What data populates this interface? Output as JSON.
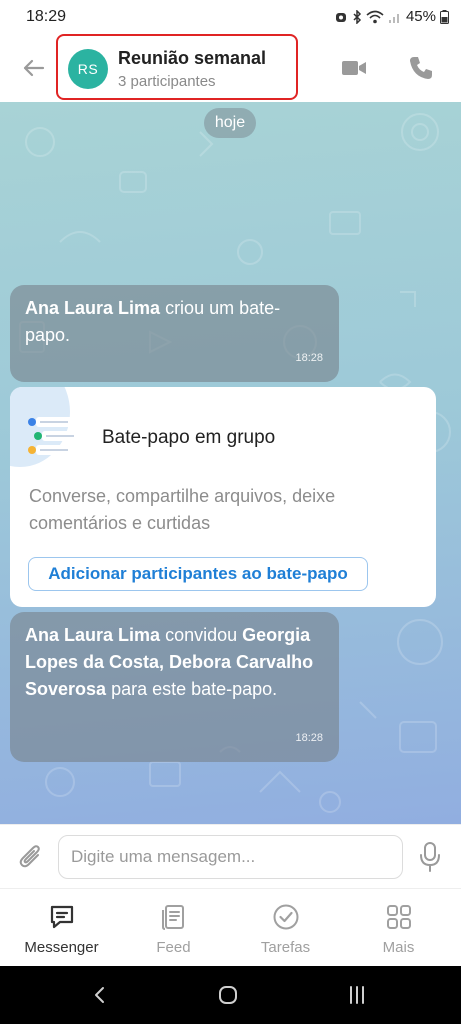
{
  "status_bar": {
    "time": "18:29",
    "battery": "45%"
  },
  "header": {
    "avatar_initials": "RS",
    "title": "Reunião semanal",
    "subtitle": "3 participantes",
    "back_icon": "arrow-left-icon",
    "video_icon": "video-camera-icon",
    "call_icon": "phone-icon"
  },
  "chat": {
    "date_label": "hoje",
    "messages": [
      {
        "author": "Ana Laura Lima",
        "text": "criou um bate-papo.",
        "time": "18:28"
      },
      {
        "author": "Ana Laura Lima",
        "text_pre": "convidou",
        "invitees": "Georgia Lopes da Costa, Debora Carvalho Soverosa",
        "text_post": "para este bate-papo.",
        "time": "18:28"
      }
    ],
    "card": {
      "title": "Bate-papo em grupo",
      "description": "Converse, compartilhe arquivos, deixe comentários e curtidas",
      "button_label": "Adicionar participantes ao bate-papo"
    }
  },
  "composer": {
    "placeholder": "Digite uma mensagem...",
    "attach_icon": "paperclip-icon",
    "mic_icon": "microphone-icon"
  },
  "bottom_nav": {
    "items": [
      {
        "label": "Messenger",
        "icon": "chat-bubble-icon",
        "active": true
      },
      {
        "label": "Feed",
        "icon": "feed-icon",
        "active": false
      },
      {
        "label": "Tarefas",
        "icon": "check-circle-icon",
        "active": false
      },
      {
        "label": "Mais",
        "icon": "grid-icon",
        "active": false
      }
    ]
  },
  "colors": {
    "accent": "#1f7fd6",
    "avatar": "#2bb3a1",
    "highlight_border": "#e02424"
  }
}
